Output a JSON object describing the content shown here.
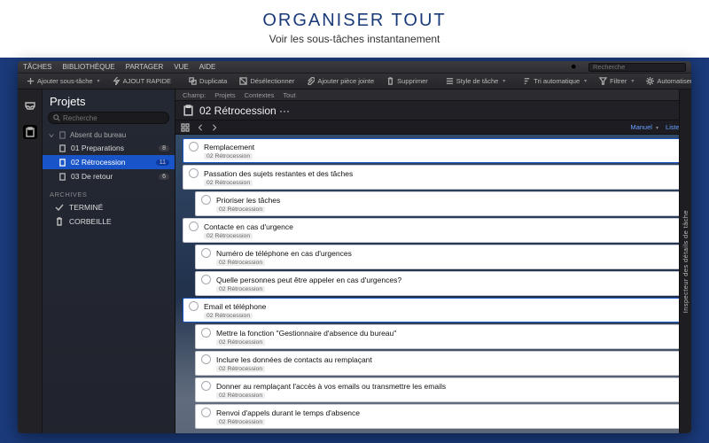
{
  "hero": {
    "title": "ORGANISER TOUT",
    "subtitle": "Voir les sous-tâches instantanement"
  },
  "menubar": {
    "items": [
      "TÂCHES",
      "BIBLIOTHÈQUE",
      "PARTAGER",
      "VUE",
      "AIDE"
    ],
    "search_placeholder": "Recherche"
  },
  "toolbar": {
    "add_subtask": "Ajouter sous-tâche",
    "quick_add": "AJOUT RAPIDE",
    "duplicate": "Duplicata",
    "deselect": "Désélectionner",
    "attach": "Ajouter pièce jointe",
    "delete": "Supprimer",
    "task_style": "Style de tâche",
    "sort_auto": "Tri automatique",
    "filter": "Filtrer",
    "automate": "Automatiser"
  },
  "sidebar": {
    "title": "Projets",
    "search_placeholder": "Recherche",
    "group_label": "Absent du bureau",
    "items": [
      {
        "label": "01 Preparations",
        "badge": "8"
      },
      {
        "label": "02 Rétrocession",
        "badge": "11"
      },
      {
        "label": "03 De retour",
        "badge": "6"
      }
    ],
    "archives_label": "ARCHIVES",
    "done_label": "TERMINÉ",
    "trash_label": "CORBEILLE"
  },
  "crumb": {
    "a": "Champ:",
    "b": "Projets",
    "c": "Contextes",
    "d": "Tout"
  },
  "header": {
    "title": "02 Rétrocession ···"
  },
  "subbar": {
    "manual": "Manuel",
    "list": "Liste"
  },
  "project_tag": "02 Rétrocession",
  "tasks": [
    {
      "title": "Remplacement",
      "indent": 0,
      "sel": true
    },
    {
      "title": "Passation des sujets restantes et des tâches",
      "indent": 0
    },
    {
      "title": "Prioriser les tâches",
      "indent": 1
    },
    {
      "title": "Contacte en cas d'urgence",
      "indent": 0
    },
    {
      "title": "Numéro de téléphone en cas d'urgences",
      "indent": 1
    },
    {
      "title": "Quelle personnes peut être appeler en cas d'urgences?",
      "indent": 1
    },
    {
      "title": "Email et téléphone",
      "indent": 0,
      "sel": true
    },
    {
      "title": "Mettre la fonction \"Gestionnaire d'absence du bureau\"",
      "indent": 1
    },
    {
      "title": "Inclure les données de contacts au remplaçant",
      "indent": 1
    },
    {
      "title": "Donner au remplaçant l'accès à vos emails ou transmettre les emails",
      "indent": 1
    },
    {
      "title": "Renvoi d'appels durant le temps d'absence",
      "indent": 1
    }
  ],
  "inspector": {
    "label": "Inspecteur des détails de tâche"
  }
}
